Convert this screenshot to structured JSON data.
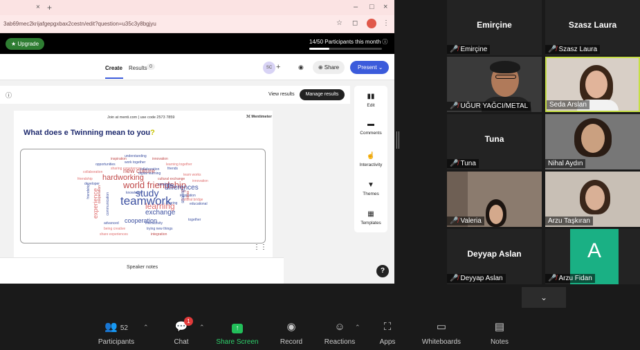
{
  "browser": {
    "tab_close": "×",
    "tab_new": "+",
    "min": "–",
    "max": "□",
    "close": "×",
    "url": "3ab69mec2krijafgepgxbax2cestn/edit?question=u35c3y8bgjyu"
  },
  "mentimeter": {
    "upgrade": "★ Upgrade",
    "participants_month": "14/50  Participants this month ⓘ",
    "participants_progress": 0.28,
    "tab_create": "Create",
    "tab_results": "Results",
    "results_count": "0",
    "avatar_initials": "SC",
    "share_label": "⊕ Share",
    "present_label": "Present  ⌄",
    "view_results": "View results",
    "manage_results": "Manage results",
    "join_text": "Join at menti.com | use code  2573 7859",
    "logo": "ℳ Mentimeter",
    "question_text": "What does e Twinning mean to you",
    "question_mark": "?",
    "speaker_notes": "Speaker notes",
    "help": "?",
    "side_panel": [
      {
        "icon": "edit-icon",
        "label": "Edit"
      },
      {
        "icon": "comments-icon",
        "label": "Comments"
      },
      {
        "icon": "interactivity-icon",
        "label": "Interactivity"
      },
      {
        "icon": "themes-icon",
        "label": "Themes"
      },
      {
        "icon": "templates-icon",
        "label": "Templates"
      }
    ],
    "word_cloud": [
      "inspiration",
      "understanding",
      "innovation",
      "work together",
      "opportunities",
      "learning together",
      "sharing experiences",
      "new culture",
      "collaboration",
      "friends",
      "collaboration",
      "digital learning",
      "team works",
      "friendship",
      "hardworking",
      "cultural exchange",
      "developer",
      "world friendship",
      "creativity",
      "innovation",
      "differences",
      "knowledge",
      "study",
      "fun",
      "inspiration",
      "teamwork",
      "cultural bridge",
      "sharing",
      "educational",
      "learning",
      "exchange",
      "cooperation",
      "together",
      "advanced",
      "interactivity",
      "being creative",
      "trying new things",
      "share experiences",
      "integration",
      "friendship",
      "experience",
      "cooperation",
      "communication",
      "sharing",
      "ideas"
    ]
  },
  "participants": [
    {
      "name": "Emirçine",
      "label": "Emirçine",
      "video": false
    },
    {
      "name": "Szasz Laura",
      "label": "Szasz Laura",
      "video": false
    },
    {
      "name": "",
      "label": "UĞUR YAĞCI/METAL",
      "video": true
    },
    {
      "name": "",
      "label": "Seda  Arslan",
      "video": true,
      "active": true
    },
    {
      "name": "Tuna",
      "label": "Tuna",
      "video": false
    },
    {
      "name": "",
      "label": "Nihal Aydın",
      "video": true
    },
    {
      "name": "",
      "label": "Valeria",
      "video": true
    },
    {
      "name": "",
      "label": "Arzu Taşkıran",
      "video": true
    },
    {
      "name": "Deyyap Aslan",
      "label": "Deyyap Aslan",
      "video": false
    },
    {
      "name": "",
      "label": "Arzu Fidan",
      "avatar_letter": "A",
      "avatar_color": "#1ab084"
    }
  ],
  "toolbar": {
    "participants_label": "Participants",
    "participants_count": "52",
    "chat_label": "Chat",
    "chat_badge": "1",
    "share_label": "Share Screen",
    "record_label": "Record",
    "reactions_label": "Reactions",
    "apps_label": "Apps",
    "whiteboards_label": "Whiteboards",
    "notes_label": "Notes"
  },
  "colors": {
    "accent": "#3b5bdb",
    "green": "#22bf5a",
    "mic_off": "#e03a3a"
  }
}
